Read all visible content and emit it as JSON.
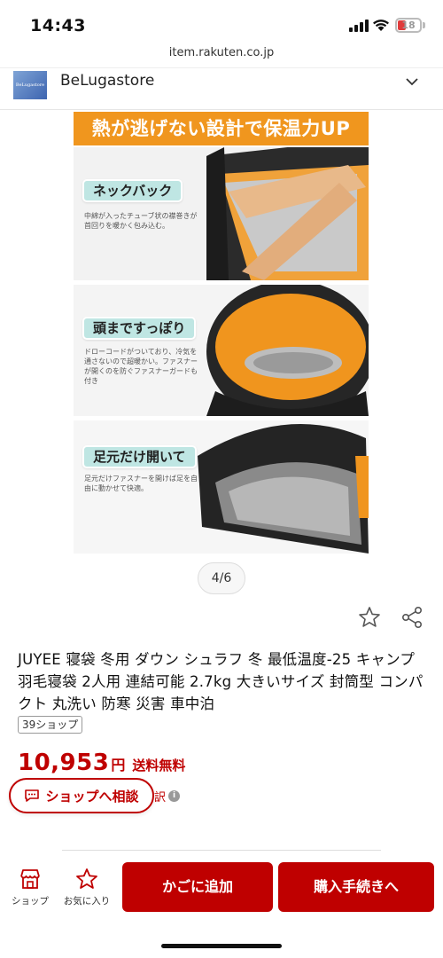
{
  "status": {
    "time": "14:43",
    "battery": "18"
  },
  "url": "item.rakuten.co.jp",
  "store": {
    "logo_text": "BeLugastore",
    "name": "BeLugastore"
  },
  "gallery": {
    "banner": "熱が逃げない設計で保温力UP",
    "panels": [
      {
        "tag": "ネックバック",
        "desc": "中綿が入ったチューブ状の襟巻きが首回りを暖かく包み込む。"
      },
      {
        "tag": "頭まですっぽり",
        "desc": "ドローコードがついており、冷気を通さないので超暖かい。ファスナーが開くのを防ぐファスナーガードも付き"
      },
      {
        "tag": "足元だけ開いて",
        "desc": "足元だけファスナーを開けば足を自由に動かせて快適。"
      }
    ],
    "counter": "4/6"
  },
  "product": {
    "title": "JUYEE 寝袋 冬用 ダウン シュラフ 冬 最低温度-25 キャンプ 羽毛寝袋 2人用 連結可能 2.7kg 大きいサイズ 封筒型 コンパクト 丸洗い 防寒 災害 車中泊",
    "shop_count": "39ショップ",
    "price": "10,953",
    "yen": "円",
    "shipping": "送料無料",
    "consult_label": "ショップへ相談",
    "breakdown": "訳"
  },
  "bottom": {
    "shop_label": "ショップ",
    "fav_label": "お気に入り",
    "cart_label": "かごに追加",
    "buy_label": "購入手続きへ"
  },
  "colors": {
    "accent": "#bf0000",
    "banner": "#f0961e",
    "tag": "#bfe6e3"
  }
}
